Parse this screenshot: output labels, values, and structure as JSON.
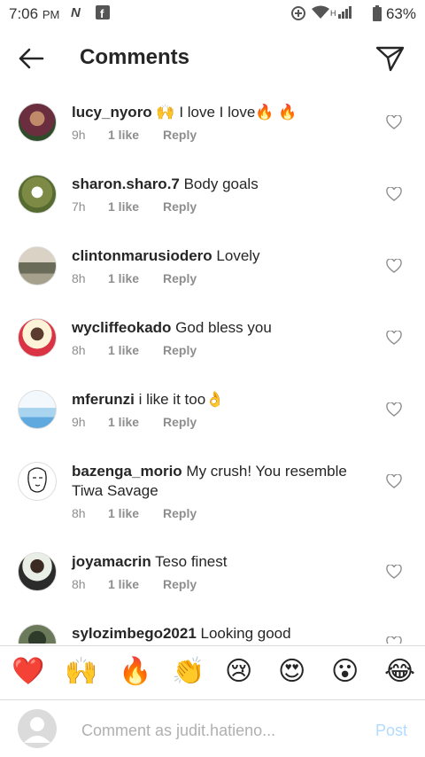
{
  "status_bar": {
    "time": "7:06",
    "ampm": "PM",
    "network_type": "H",
    "battery": "63%"
  },
  "header": {
    "title": "Comments"
  },
  "comments": [
    {
      "username": "lucy_nyoro",
      "text": " 🙌 I love I love🔥 🔥",
      "time": "9h",
      "likes": "1 like",
      "reply": "Reply"
    },
    {
      "username": "sharon.sharo.7",
      "text": " Body goals",
      "time": "7h",
      "likes": "1 like",
      "reply": "Reply"
    },
    {
      "username": "clintonmarusiodero",
      "text": " Lovely",
      "time": "8h",
      "likes": "1 like",
      "reply": "Reply"
    },
    {
      "username": "wycliffeokado",
      "text": " God bless you",
      "time": "8h",
      "likes": "1 like",
      "reply": "Reply"
    },
    {
      "username": "mferunzi",
      "text": " i like it too👌",
      "time": "9h",
      "likes": "1 like",
      "reply": "Reply"
    },
    {
      "username": "bazenga_morio",
      "text": " My crush! You resemble Tiwa Savage",
      "time": "8h",
      "likes": "1 like",
      "reply": "Reply"
    },
    {
      "username": "joyamacrin",
      "text": " Teso finest",
      "time": "8h",
      "likes": "1 like",
      "reply": "Reply"
    },
    {
      "username": "sylozimbego2021",
      "text": " Looking good",
      "time": "",
      "likes": "",
      "reply": ""
    }
  ],
  "emoji_bar": [
    "❤️",
    "🙌",
    "🔥",
    "👏",
    "😢",
    "😍",
    "😮",
    "😂"
  ],
  "input": {
    "placeholder": "Comment as judit.hatieno...",
    "post_label": "Post"
  },
  "colors": {
    "text": "#262626",
    "meta": "#8e8e8e",
    "post_disabled": "#b3dbff",
    "divider": "#dbdbdb"
  }
}
